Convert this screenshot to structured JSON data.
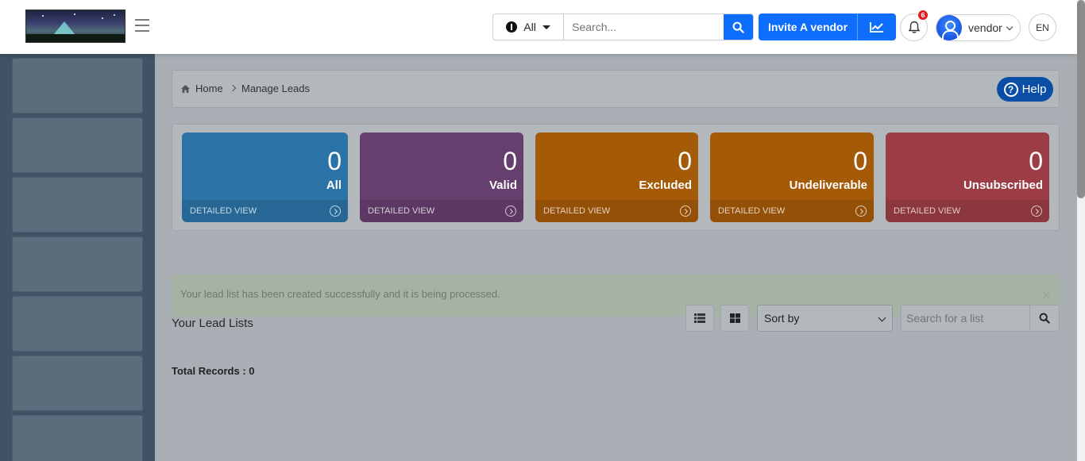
{
  "header": {
    "search_scope": "All",
    "search_placeholder": "Search...",
    "invite_label": "Invite A vendor",
    "notification_count": "6",
    "user_name": "vendor",
    "language": "EN"
  },
  "breadcrumb": {
    "home": "Home",
    "current": "Manage Leads"
  },
  "help_label": "Help",
  "stats": [
    {
      "value": "0",
      "label": "All",
      "footer": "DETAILED VIEW",
      "color": "#2b73a6"
    },
    {
      "value": "0",
      "label": "Valid",
      "footer": "DETAILED VIEW",
      "color": "#673f6f"
    },
    {
      "value": "0",
      "label": "Excluded",
      "footer": "DETAILED VIEW",
      "color": "#a55a07"
    },
    {
      "value": "0",
      "label": "Undeliverable",
      "footer": "DETAILED VIEW",
      "color": "#a55a07"
    },
    {
      "value": "0",
      "label": "Unsubscribed",
      "footer": "DETAILED VIEW",
      "color": "#9c3d45"
    }
  ],
  "alert": {
    "message": "Your lead list has been created successfully and it is being processed.",
    "close": "×"
  },
  "lists": {
    "title": "Your Lead Lists",
    "sort_label": "Sort by",
    "search_placeholder": "Search for a list",
    "total": "Total Records : 0"
  },
  "colors": {
    "primary": "#0d6efd",
    "help": "#0b4ea5",
    "sidebar": "#3f5364",
    "overlay": "#a9afb4"
  }
}
